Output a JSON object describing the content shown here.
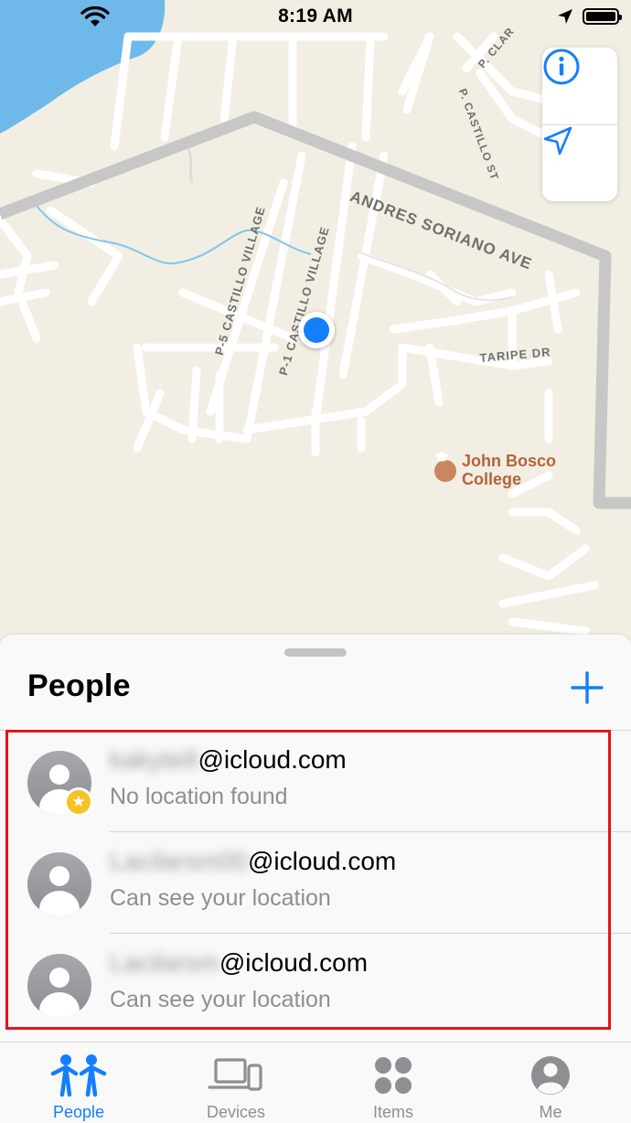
{
  "status_bar": {
    "time": "8:19 AM"
  },
  "map": {
    "street_labels": [
      "ANDRES SORIANO AVE",
      "P-5 CASTILLO VILLAGE",
      "P-1 CASTILLO VILLAGE",
      "P. CASTILLO ST",
      "P. CLAR",
      "TARIPE DR"
    ],
    "poi": {
      "name_line1": "John Bosco",
      "name_line2": "College",
      "icon": "graduation-cap-icon",
      "color": "#b5643a"
    },
    "controls": {
      "info_icon": "info-icon",
      "locate_icon": "location-arrow-icon"
    },
    "accent": "#157efb"
  },
  "sheet": {
    "title": "People",
    "add_icon": "plus-icon"
  },
  "people": [
    {
      "email_prefix": "kakyte8",
      "email_domain": "@icloud.com",
      "status": "No location found",
      "badge": "star"
    },
    {
      "email_prefix": "Lacilarsm00",
      "email_domain": "@icloud.com",
      "status": "Can see your location",
      "badge": ""
    },
    {
      "email_prefix": "Lacilarsm",
      "email_domain": "@icloud.com",
      "status": "Can see your location",
      "badge": ""
    }
  ],
  "highlight_color": "#e2151b",
  "tabs": [
    {
      "label": "People",
      "icon": "people-icon",
      "active": true
    },
    {
      "label": "Devices",
      "icon": "devices-icon",
      "active": false
    },
    {
      "label": "Items",
      "icon": "items-icon",
      "active": false
    },
    {
      "label": "Me",
      "icon": "me-icon",
      "active": false
    }
  ]
}
